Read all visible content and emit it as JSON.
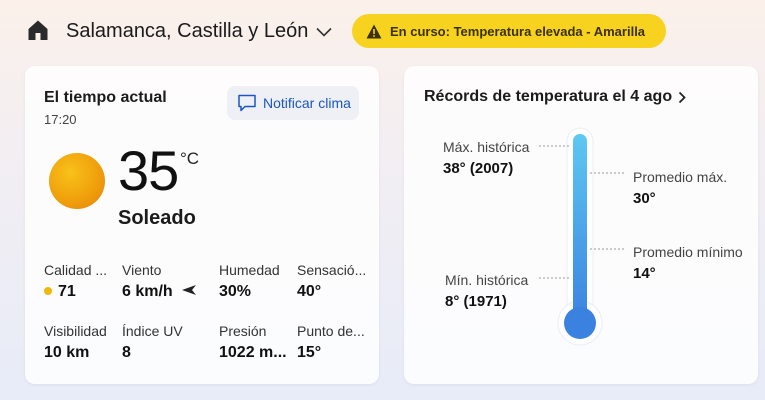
{
  "header": {
    "location": "Salamanca, Castilla y León",
    "alert": "En curso: Temperatura elevada - Amarilla"
  },
  "current": {
    "title": "El tiempo actual",
    "time": "17:20",
    "notify_label": "Notificar clima",
    "temperature": "35",
    "unit": "°C",
    "condition": "Soleado",
    "metrics": [
      {
        "label": "Calidad ...",
        "value": "71"
      },
      {
        "label": "Viento",
        "value": "6 km/h"
      },
      {
        "label": "Humedad",
        "value": "30%"
      },
      {
        "label": "Sensació...",
        "value": "40°"
      },
      {
        "label": "Visibilidad",
        "value": "10 km"
      },
      {
        "label": "Índice UV",
        "value": "8"
      },
      {
        "label": "Presión",
        "value": "1022 m..."
      },
      {
        "label": "Punto de...",
        "value": "15°"
      }
    ]
  },
  "records": {
    "title": "Récords de temperatura el 4 ago",
    "max_hist_label": "Máx. histórica",
    "max_hist_value": "38° (2007)",
    "avg_max_label": "Promedio máx.",
    "avg_max_value": "30°",
    "avg_min_label": "Promedio mínimo",
    "avg_min_value": "14°",
    "min_hist_label": "Mín. histórica",
    "min_hist_value": "8° (1971)"
  },
  "colors": {
    "alert_bg": "#f7d21e",
    "accent_blue": "#1a56c2",
    "aqi_dot": "#f0b70c",
    "thermo_top": "#5ec8f2",
    "thermo_bottom": "#3b82e0"
  }
}
